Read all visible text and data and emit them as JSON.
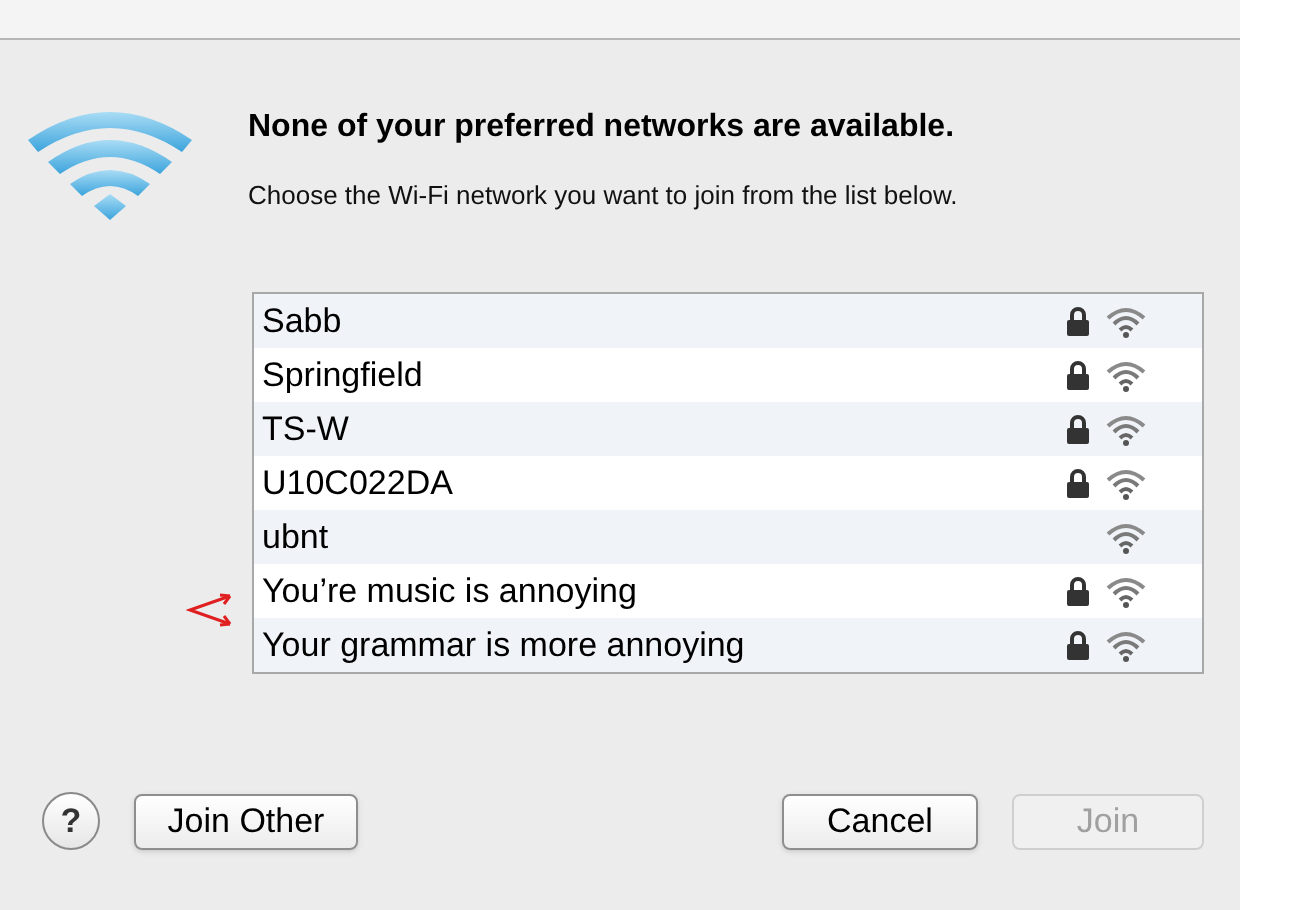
{
  "heading": "None of your preferred networks are available.",
  "message": "Choose the Wi-Fi network you want to join from the list below.",
  "networks": [
    {
      "name": "Sabb",
      "secured": true
    },
    {
      "name": "Springfield",
      "secured": true
    },
    {
      "name": "TS-W",
      "secured": true
    },
    {
      "name": "U10C022DA",
      "secured": true
    },
    {
      "name": "ubnt",
      "secured": false
    },
    {
      "name": "You’re music is annoying",
      "secured": true
    },
    {
      "name": "Your grammar is more annoying",
      "secured": true
    }
  ],
  "help_button": {
    "label": "?"
  },
  "buttons": [
    {
      "label": "Join Other",
      "disabled": false
    },
    {
      "label": "Cancel",
      "disabled": false
    },
    {
      "label": "Join",
      "disabled": true
    }
  ]
}
